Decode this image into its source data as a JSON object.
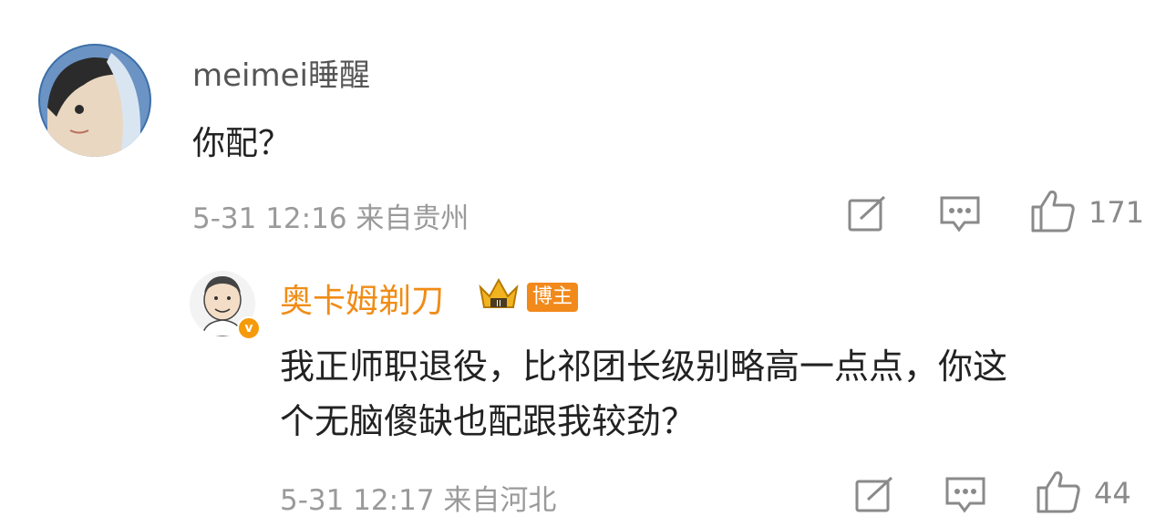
{
  "comment": {
    "username": "meimei睡醒",
    "content": "你配？",
    "meta": "5-31 12:16  来自贵州",
    "likes": "171"
  },
  "reply": {
    "username": "奥卡姆剃刀",
    "badge": "博主",
    "verified_icon": "v-badge",
    "content_line1": "我正师职退役，比祁团长级别略高一点点，你这",
    "content_line2": "个无脑傻缺也配跟我较劲？",
    "meta": "5-31 12:17  来自河北",
    "likes": "44"
  },
  "colors": {
    "username_orange": "#f08c16",
    "meta_gray": "#9a9a9a",
    "text": "#222222"
  }
}
